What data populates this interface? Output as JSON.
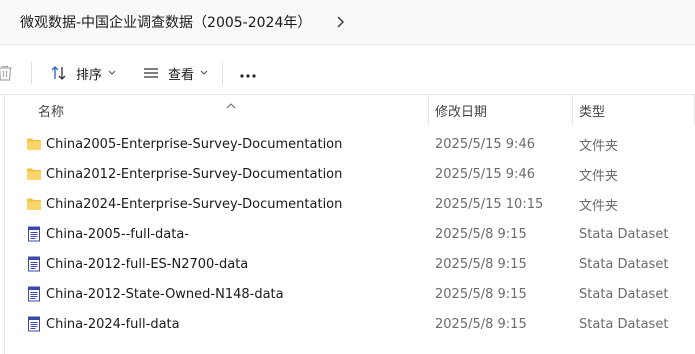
{
  "address": {
    "path": "微观数据-中国企业调查数据（2005-2024年）"
  },
  "toolbar": {
    "sort_label": "排序",
    "view_label": "查看",
    "more_label": "···"
  },
  "columns": {
    "name": "名称",
    "date": "修改日期",
    "type": "类型"
  },
  "files": [
    {
      "name": "China2005-Enterprise-Survey-Documentation",
      "date": "2025/5/15 9:46",
      "type": "文件夹",
      "icon": "folder-icon"
    },
    {
      "name": "China2012-Enterprise-Survey-Documentation",
      "date": "2025/5/15 9:46",
      "type": "文件夹",
      "icon": "folder-icon"
    },
    {
      "name": "China2024-Enterprise-Survey-Documentation",
      "date": "2025/5/15 10:15",
      "type": "文件夹",
      "icon": "folder-icon"
    },
    {
      "name": "China-2005--full-data-",
      "date": "2025/5/8 9:15",
      "type": "Stata Dataset",
      "icon": "stata-file-icon"
    },
    {
      "name": "China-2012-full-ES-N2700-data",
      "date": "2025/5/8 9:15",
      "type": "Stata Dataset",
      "icon": "stata-file-icon"
    },
    {
      "name": "China-2012-State-Owned-N148-data",
      "date": "2025/5/8 9:15",
      "type": "Stata Dataset",
      "icon": "stata-file-icon"
    },
    {
      "name": "China-2024-full-data",
      "date": "2025/5/8 9:15",
      "type": "Stata Dataset",
      "icon": "stata-file-icon"
    }
  ],
  "colors": {
    "folder": "#f5c241",
    "stata_file": "#3b4aa8",
    "secondary_text": "#6b6b6b"
  }
}
